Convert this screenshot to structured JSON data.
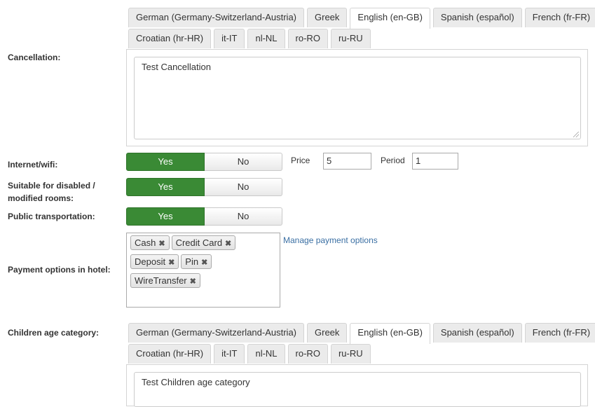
{
  "languages": [
    "German (Germany-Switzerland-Austria)",
    "Greek",
    "English (en-GB)",
    "Spanish (español)",
    "French (fr-FR)",
    "Croatian (hr-HR)",
    "it-IT",
    "nl-NL",
    "ro-RO",
    "ru-RU"
  ],
  "active_language": "English (en-GB)",
  "cancellation": {
    "label": "Cancellation:",
    "value": "Test Cancellation"
  },
  "internet": {
    "label": "Internet/wifi:",
    "yes": "Yes",
    "no": "No",
    "selected": "Yes",
    "price_label": "Price",
    "price_value": "5",
    "period_label": "Period",
    "period_value": "1"
  },
  "disabled": {
    "label_line1": "Suitable for disabled /",
    "label_line2": "modified rooms:",
    "yes": "Yes",
    "no": "No",
    "selected": "Yes"
  },
  "transport": {
    "label": "Public transportation:",
    "yes": "Yes",
    "no": "No",
    "selected": "Yes"
  },
  "payment": {
    "label": "Payment options in hotel:",
    "options": [
      "Cash",
      "Credit Card",
      "Deposit",
      "Pin",
      "WireTransfer"
    ],
    "manage_link": "Manage payment options"
  },
  "children": {
    "label": "Children age category:",
    "value": "Test Children age category"
  },
  "colors": {
    "yes_active": "#3a8a35",
    "link": "#3a6fa3"
  }
}
